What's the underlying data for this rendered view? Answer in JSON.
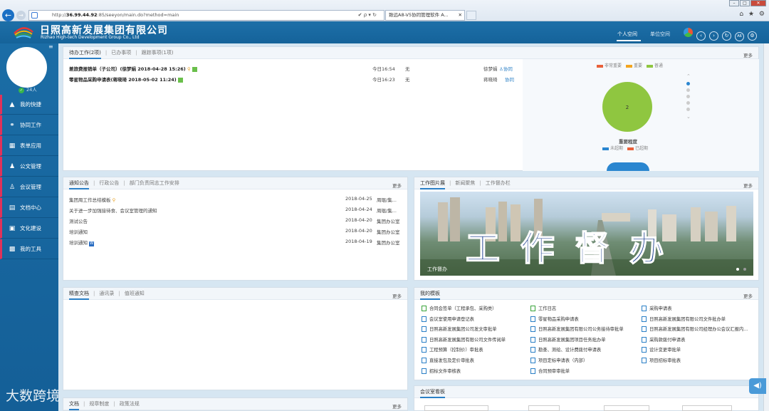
{
  "browser": {
    "url_scheme": "http://",
    "url_host": "36.99.44.92",
    "url_rest": ":85/seeyon/main.do?method=main",
    "tab_title": "致远A8-V5协同管理软件 A...",
    "tab_close": "✕",
    "nav_icons": "✔ ρ ▾ ↻",
    "right_icons": "⌂ ★ ⚙",
    "min": "–",
    "max": "□",
    "close": "✕"
  },
  "header": {
    "company_cn": "日照高新发展集团有限公司",
    "company_en": "Rizhao High-tech Development Group Co., Ltd",
    "space_personal": "个人空间",
    "space_unit": "单位空间",
    "icons": [
      "theme-icon",
      "back-icon",
      "forward-icon",
      "refresh-icon",
      "a6-icon",
      "settings-icon"
    ],
    "icon_glyphs": [
      "",
      "‹",
      "›",
      "↻",
      "A6",
      "⚙"
    ]
  },
  "sidebar": {
    "menu_glyph": "≡",
    "people_count": "24人",
    "check": "✓",
    "items": [
      {
        "label": "我的快捷",
        "glyph": "▲"
      },
      {
        "label": "协同工作",
        "glyph": "⚭"
      },
      {
        "label": "表单应用",
        "glyph": "▦"
      },
      {
        "label": "公文管理",
        "glyph": "♟"
      },
      {
        "label": "会议管理",
        "glyph": "♙"
      },
      {
        "label": "文档中心",
        "glyph": "▤"
      },
      {
        "label": "文化建设",
        "glyph": "▣"
      },
      {
        "label": "我的工具",
        "glyph": "▩"
      }
    ]
  },
  "pending": {
    "tabs": [
      "待办工作(2项)",
      "已办事项",
      "跟踪事项(1项)"
    ],
    "more": "更多",
    "rows": [
      {
        "title": "差旅费报销单（子公司）(徐梦娟 2018-04-28 15:26)",
        "time": "今日16:54",
        "flag": "无",
        "person": "徐梦娟",
        "type": "协同"
      },
      {
        "title": "零星物品采购申请表(蒋晓琦 2018-05-02 11:24)",
        "time": "今日16:23",
        "flag": "无",
        "person": "蒋晓琦",
        "type": "协同"
      }
    ],
    "chart": {
      "legend_top": [
        "非常重要",
        "重要",
        "普通"
      ],
      "legend_top_colors": [
        "#e9603a",
        "#f3a51f",
        "#8fc640"
      ],
      "value": "2",
      "title": "重要程度",
      "legend_bottom": [
        "未超期",
        "已超期"
      ],
      "legend_bottom_colors": [
        "#2a86d0",
        "#e9603a"
      ]
    },
    "chart_data": {
      "type": "pie",
      "title": "重要程度",
      "slices": [
        {
          "name": "普通",
          "value": 2
        }
      ]
    }
  },
  "notice": {
    "tabs": [
      "通知公告",
      "行政公告",
      "部门负责同志工作安排"
    ],
    "more": "更多",
    "rows": [
      {
        "title": "集团周工作总结模板",
        "date": "2018-04-25",
        "org": "周琨/集..."
      },
      {
        "title": "关于进一步加强接待食、会议室管理的通知",
        "date": "2018-04-24",
        "org": "周琨/集..."
      },
      {
        "title": "测试公告",
        "date": "2018-04-20",
        "org": "集团办公室"
      },
      {
        "title": "培训通知",
        "date": "2018-04-20",
        "org": "集团办公室"
      },
      {
        "title": "培训通知",
        "date": "2018-04-19",
        "org": "集团办公室"
      }
    ]
  },
  "photo": {
    "tabs": [
      "工作图片展",
      "新闻聚焦",
      "工作督办栏"
    ],
    "more": "更多",
    "banner_text": "工 作 督 办",
    "caption": "工作督办"
  },
  "docs": {
    "tabs": [
      "精查文档",
      "通讯录",
      "值班通知"
    ],
    "more": "更多"
  },
  "templates": {
    "tabs": [
      "我的模板"
    ],
    "more": "更多",
    "items": [
      "合同会签单（工程承包、采购类）",
      "工作日志",
      "采购申请表",
      "会议室使用申请登记表",
      "零星物品采购申请表",
      "日照高新发展集团有限公司文件批办单",
      "日照高新发展集团公司发文审批单",
      "日照高新发展集团有限公司公务接待审批单",
      "日照高新发展集团有限公司经理办公会议汇报内...",
      "日照高新发展集团有限公司文件传阅单",
      "日照高新发展集团项目任务批办单",
      "采购款拨付申请表",
      "工程预算（控制价）审批表",
      "勘查、测绘、设计费拨付申请表",
      "设计变更审批单",
      "直接发包及定价审批表",
      "项目定标申请表（内部）",
      "项目招标审批表",
      "招标文件审核表",
      "合同预审审批单"
    ]
  },
  "meeting": {
    "tabs": [
      "会议室看板"
    ]
  },
  "rules": {
    "tabs": [
      "文档",
      "规章制度",
      "政策法规"
    ],
    "more": "更多"
  },
  "watermark": "大数跨境"
}
